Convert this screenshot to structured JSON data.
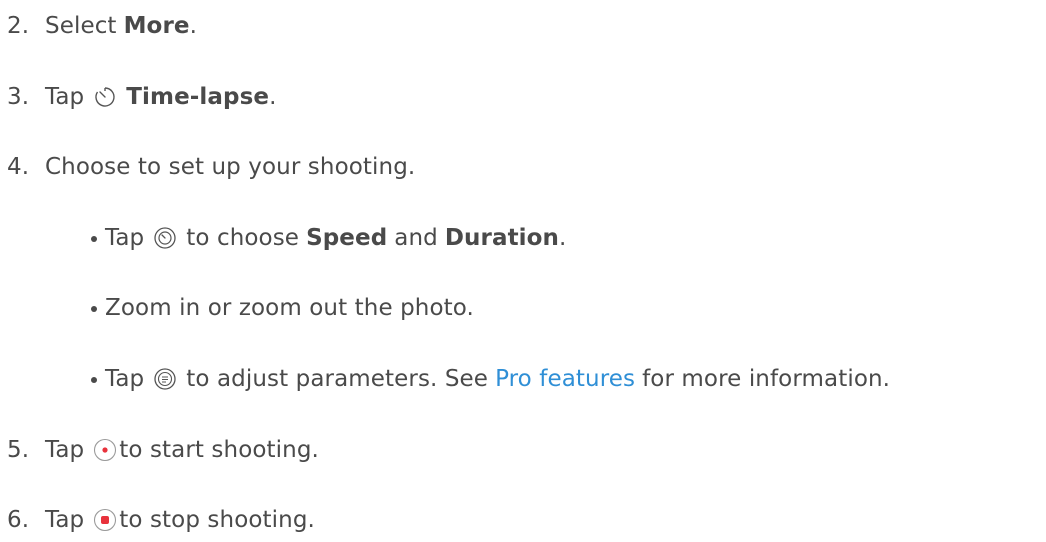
{
  "steps": {
    "s2": {
      "num": "2.",
      "text1": "Select ",
      "bold": "More",
      "text2": "."
    },
    "s3": {
      "num": "3.",
      "text1": "Tap ",
      "icon": "timelapse-icon",
      "bold": "Time-lapse",
      "text2": "."
    },
    "s4": {
      "num": "4.",
      "text1": "Choose to set up your shooting."
    },
    "s5": {
      "num": "5.",
      "text1": "Tap ",
      "icon": "record-start-icon",
      "text2": " to start shooting."
    },
    "s6": {
      "num": "6.",
      "text1": "Tap ",
      "icon": "record-stop-icon",
      "text2": " to stop shooting."
    }
  },
  "bullets": {
    "b1": {
      "text1": "Tap ",
      "icon": "speed-dial-icon",
      "text2": " to choose ",
      "bold1": "Speed",
      "text3": " and ",
      "bold2": "Duration",
      "text4": "."
    },
    "b2": {
      "text1": "Zoom in or zoom out the photo."
    },
    "b3": {
      "text1": "Tap ",
      "icon": "parameters-icon",
      "text2": " to adjust parameters. See ",
      "link": "Pro features",
      "text3": " for more information."
    }
  },
  "colors": {
    "text": "#4a4a4a",
    "link": "#2f8fd6",
    "record_red": "#e8323c",
    "icon_stroke": "#555555"
  }
}
